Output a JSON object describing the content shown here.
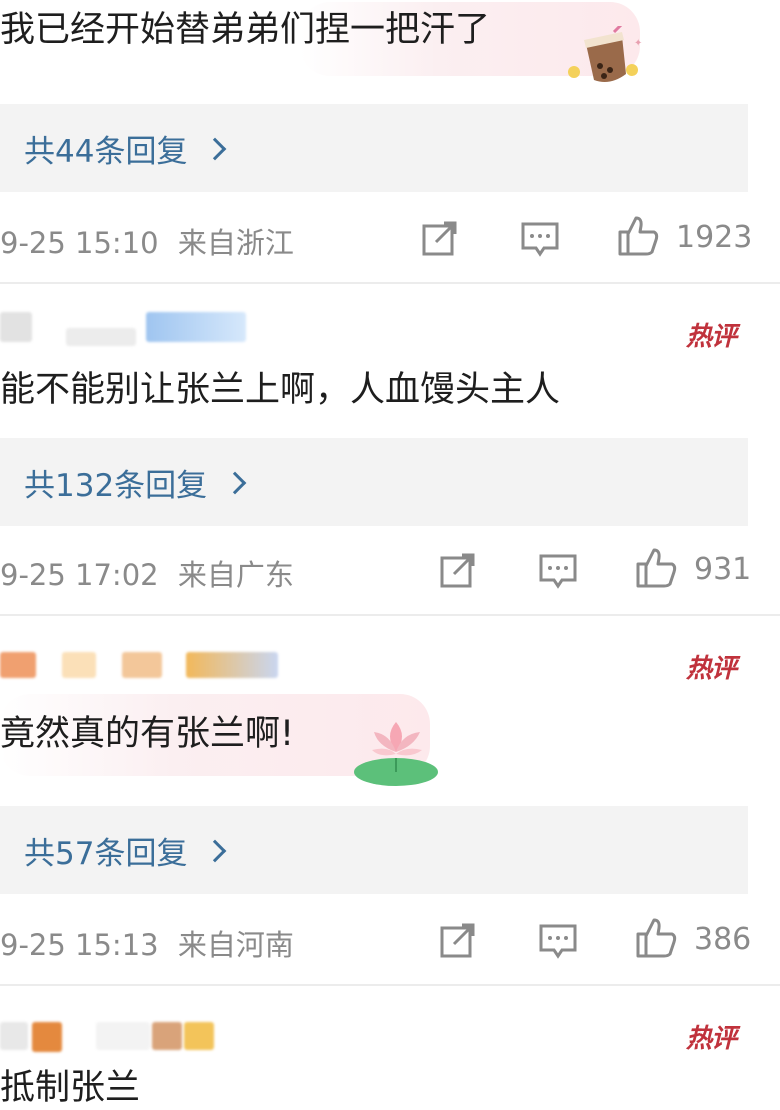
{
  "comments": [
    {
      "text": "我已经开始替弟弟们捏一把汗了",
      "replies": "共44条回复",
      "time": "9-25 15:10",
      "location": "来自浙江",
      "likes": "1923"
    },
    {
      "badge": "热评",
      "text": "能不能别让张兰上啊，人血馒头主人",
      "replies": "共132条回复",
      "time": "9-25 17:02",
      "location": "来自广东",
      "likes": "931"
    },
    {
      "badge": "热评",
      "text": "竟然真的有张兰啊!",
      "replies": "共57条回复",
      "time": "9-25 15:13",
      "location": "来自河南",
      "likes": "386"
    },
    {
      "badge": "热评",
      "text": "抵制张兰"
    }
  ],
  "icons": [
    "share-icon",
    "comment-icon",
    "like-icon",
    "chevron-right-icon"
  ],
  "colors": {
    "link": "#3b6e99",
    "meta": "#8a8a8a",
    "hot_badge": "#c0323c",
    "reply_bg": "#f3f3f3"
  }
}
